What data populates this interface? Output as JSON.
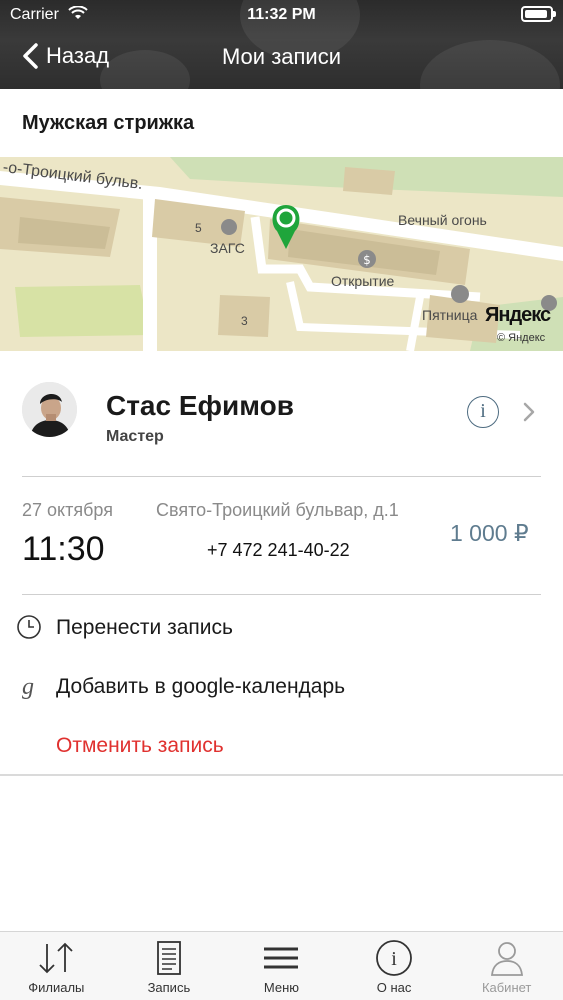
{
  "status_bar": {
    "carrier": "Carrier",
    "time": "11:32 PM"
  },
  "nav": {
    "back_label": "Назад",
    "title": "Мои записи"
  },
  "service": {
    "title": "Мужская стрижка"
  },
  "map": {
    "labels": {
      "street": "-о-Троицкий бульв.",
      "eternal_fire": "Вечный огонь",
      "zags": "ЗАГС",
      "bank": "Открытие",
      "shop": "Пятница",
      "house_5": "5",
      "house_3": "3",
      "provider": "Яндекс",
      "copyright": "© Яндекс"
    },
    "pin_color": "#1fa53b"
  },
  "master": {
    "name": "Стас Ефимов",
    "role": "Мастер",
    "info_glyph": "i"
  },
  "appointment": {
    "date": "27 октября",
    "time": "11:30",
    "address": "Свято-Троицкий бульвар, д.1",
    "phone": "+7 472 241-40-22",
    "price": "1 000 ₽"
  },
  "actions": {
    "reschedule": "Перенести запись",
    "google_calendar": "Добавить в google-календарь",
    "cancel": "Отменить запись",
    "cancel_color": "#e0312f"
  },
  "tabbar": {
    "items": [
      {
        "label": "Филиалы",
        "icon": "sort-arrows-icon"
      },
      {
        "label": "Запись",
        "icon": "document-icon"
      },
      {
        "label": "Меню",
        "icon": "hamburger-menu-icon"
      },
      {
        "label": "О нас",
        "icon": "info-icon"
      },
      {
        "label": "Кабинет",
        "icon": "user-icon"
      }
    ]
  }
}
